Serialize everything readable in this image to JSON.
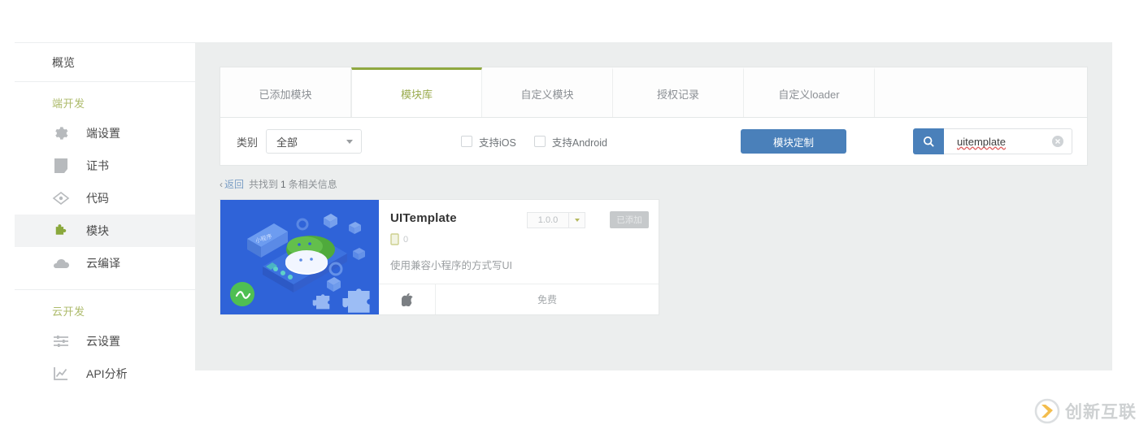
{
  "sidebar": {
    "overview": {
      "label": "概览"
    },
    "sections": [
      {
        "title": "端开发",
        "items": [
          {
            "label": "端设置",
            "icon": "gear-icon",
            "active": false
          },
          {
            "label": "证书",
            "icon": "certificate-icon",
            "active": false
          },
          {
            "label": "代码",
            "icon": "code-icon",
            "active": false
          },
          {
            "label": "模块",
            "icon": "puzzle-icon",
            "active": true
          },
          {
            "label": "云编译",
            "icon": "cloud-icon",
            "active": false
          }
        ]
      },
      {
        "title": "云开发",
        "items": [
          {
            "label": "云设置",
            "icon": "sliders-icon",
            "active": false
          },
          {
            "label": "API分析",
            "icon": "chart-icon",
            "active": false
          }
        ]
      }
    ]
  },
  "tabs": [
    {
      "label": "已添加模块",
      "active": false
    },
    {
      "label": "模块库",
      "active": true
    },
    {
      "label": "自定义模块",
      "active": false
    },
    {
      "label": "授权记录",
      "active": false
    },
    {
      "label": "自定义loader",
      "active": false
    }
  ],
  "filter": {
    "category_label": "类别",
    "category_value": "全部",
    "category_options": [
      "全部"
    ],
    "checkboxes": [
      {
        "label": "支持iOS",
        "checked": false
      },
      {
        "label": "支持Android",
        "checked": false
      }
    ],
    "customize_button": "模块定制"
  },
  "search": {
    "value": "uitemplate",
    "placeholder": "",
    "icon": "search-icon",
    "clear_icon": "clear-circle-icon"
  },
  "result_info": {
    "back_chevron": "‹",
    "back_label": "返回",
    "prefix": "共找到",
    "count": "1",
    "suffix": "条相关信息"
  },
  "card": {
    "title": "UITemplate",
    "version": "1.0.0",
    "added_button": "已添加",
    "device_count": "0",
    "description": "使用兼容小程序的方式写UI",
    "platform_icon": "apple-icon",
    "price": "免费",
    "thumb_bg": "#2f63d8"
  },
  "watermark": {
    "text": "创新互联",
    "logo_letter": "X"
  },
  "colors": {
    "accent_green": "#8fa840",
    "accent_blue": "#4a80ba",
    "section_title": "#adbb6b",
    "panel_bg": "#eceeee"
  }
}
